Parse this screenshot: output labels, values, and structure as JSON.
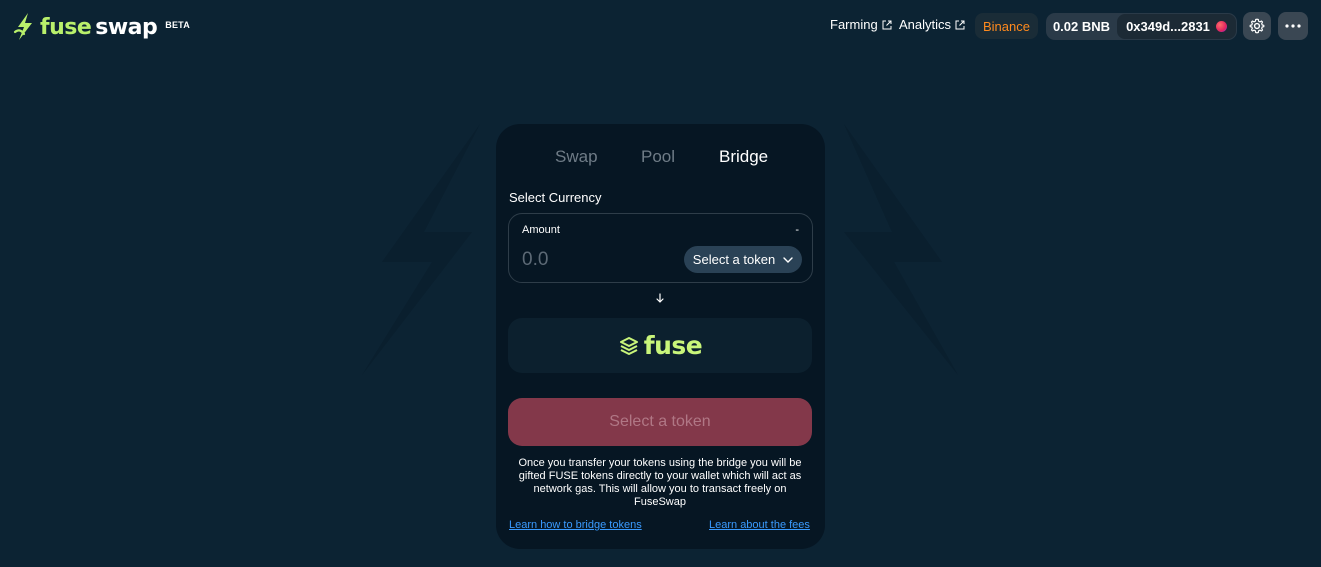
{
  "app": {
    "logo_fuse": "fuse",
    "logo_swap": "swap",
    "logo_beta": "BETA"
  },
  "header": {
    "farming_label": "Farming",
    "analytics_label": "Analytics",
    "network_label": "Binance",
    "wallet_balance": "0.02 BNB",
    "wallet_address": "0x349d...2831"
  },
  "tabs": {
    "swap": "Swap",
    "pool": "Pool",
    "bridge": "Bridge",
    "active": "Bridge"
  },
  "bridge": {
    "section_label": "Select Currency",
    "amount_label": "Amount",
    "amount_balance": "-",
    "amount_placeholder": "0.0",
    "token_select_label": "Select a token",
    "destination_wordmark": "fuse",
    "cta_label": "Select a token",
    "info_text": "Once you transfer your tokens using the bridge you will be gifted FUSE tokens directly to your wallet which will act as network gas. This will allow you to transact freely on FuseSwap",
    "link_bridge_tokens": "Learn how to bridge tokens",
    "link_fees": "Learn about the fees"
  },
  "icons": {
    "logo_bolt": "lightning-bolt-icon",
    "external_link": "external-link-icon",
    "settings": "gear-icon",
    "more": "more-dots-icon",
    "chevron": "chevron-down-icon",
    "arrow": "arrow-down-icon",
    "fuse_mark": "fuse-layers-icon"
  },
  "colors": {
    "background": "#0c2333",
    "card": "#061623",
    "accent_green": "#b9f06b",
    "network_orange": "#ff8a1e",
    "cta_disabled": "#83384a",
    "link_blue": "#3a9bff"
  }
}
